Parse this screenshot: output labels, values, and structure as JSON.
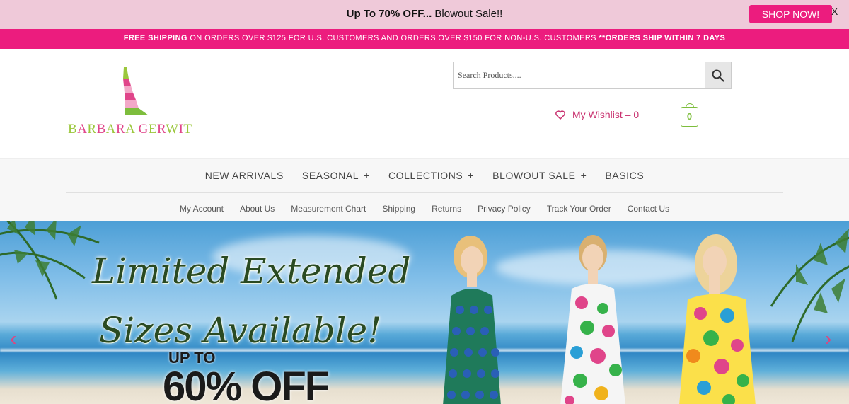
{
  "promo": {
    "bold": "Up To 70% OFF...",
    "text": " Blowout Sale!!",
    "cta": "SHOP NOW!",
    "close": "X"
  },
  "shipping": {
    "bold1": "FREE SHIPPING",
    "text": " ON ORDERS OVER $125 FOR U.S. CUSTOMERS AND ORDERS OVER $150 FOR NON-U.S. CUSTOMERS ",
    "bold2": "**ORDERS SHIP WITHIN 7 DAYS"
  },
  "header": {
    "logo_text": "BARBARA GERWIT",
    "search_placeholder": "Search Products....",
    "wishlist_label": "My Wishlist – 0",
    "cart_count": "0"
  },
  "main_nav": [
    {
      "label": "NEW ARRIVALS",
      "has_submenu": false
    },
    {
      "label": "SEASONAL",
      "has_submenu": true
    },
    {
      "label": "COLLECTIONS",
      "has_submenu": true
    },
    {
      "label": "BLOWOUT SALE",
      "has_submenu": true
    },
    {
      "label": "BASICS",
      "has_submenu": false
    }
  ],
  "sub_nav": [
    "My Account",
    "About Us",
    "Measurement Chart",
    "Shipping",
    "Returns",
    "Privacy Policy",
    "Track Your Order",
    "Contact Us"
  ],
  "hero": {
    "title_line1": "Limited Extended",
    "title_line2": "Sizes Available!",
    "off_small": "UP TO",
    "off_big": "60% OFF"
  },
  "colors": {
    "brand_pink": "#ec1c7e",
    "promo_bg": "#efc9d9",
    "logo_green": "#7dbd3c",
    "wishlist_pink": "#c8306e"
  },
  "icons": {
    "search": "search-icon",
    "wishlist": "heart-icon",
    "cart": "shopping-bag-icon",
    "prev": "chevron-left-icon",
    "next": "chevron-right-icon"
  }
}
